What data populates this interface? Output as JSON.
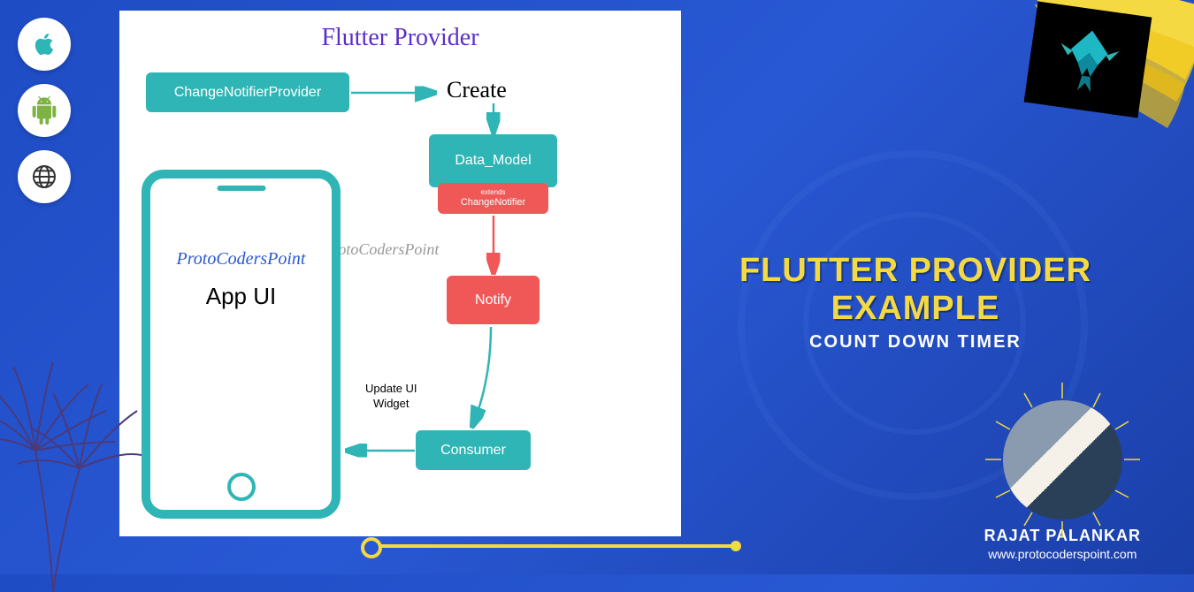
{
  "diagram": {
    "title": "Flutter Provider",
    "boxes": {
      "cnp": "ChangeNotifierProvider",
      "create": "Create",
      "datamodel": "Data_Model",
      "changenotifier_sm": "extends",
      "changenotifier": "ChangeNotifier",
      "notify": "Notify",
      "consumer": "Consumer",
      "updateui": "Update UI\nWidget"
    },
    "watermark": "ProtoCodersPoint",
    "phone": {
      "brand": "ProtoCodersPoint",
      "label": "App UI"
    }
  },
  "right": {
    "title": "FLUTTER PROVIDER EXAMPLE",
    "subtitle": "COUNT DOWN TIMER"
  },
  "author": {
    "name": "RAJAT PALANKAR",
    "url": "www.protocoderspoint.com"
  },
  "colors": {
    "teal": "#2fb5b5",
    "red": "#f05858",
    "yellow": "#f5d942",
    "blue": "#2958d4",
    "purple": "#5b2ec7"
  }
}
